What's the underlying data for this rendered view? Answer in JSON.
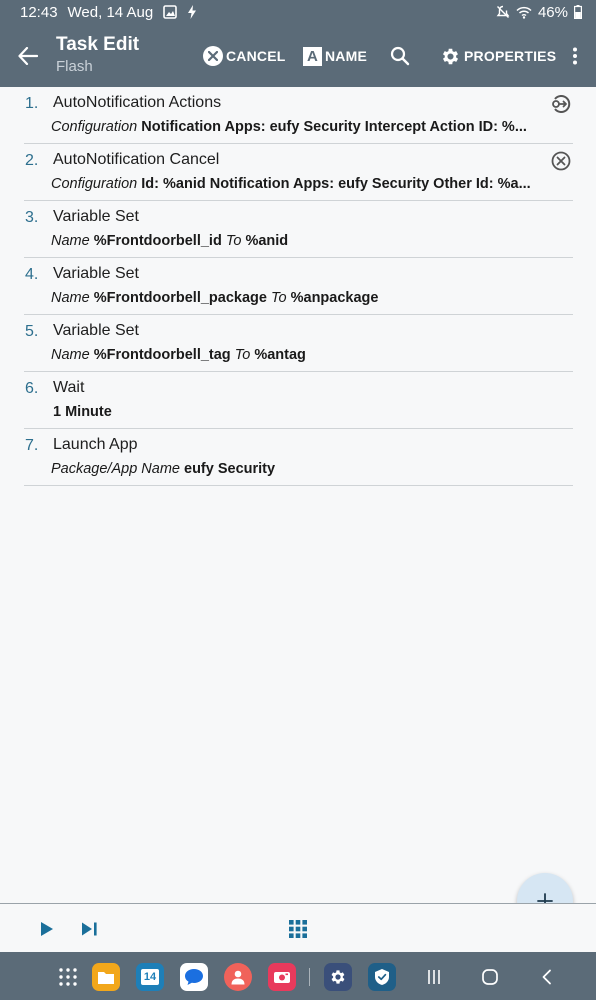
{
  "status_bar": {
    "time": "12:43",
    "date": "Wed, 14 Aug",
    "battery": "46%"
  },
  "app_bar": {
    "title": "Task Edit",
    "subtitle": "Flash",
    "cancel_label": "CANCEL",
    "name_label": "NAME",
    "name_icon_letter": "A",
    "properties_label": "PROPERTIES"
  },
  "actions": [
    {
      "num": "1.",
      "title": "AutoNotification Actions",
      "label": "Configuration",
      "value": "Notification Apps: eufy Security Intercept Action ID: %...",
      "icon": "plugin-exit-icon"
    },
    {
      "num": "2.",
      "title": "AutoNotification Cancel",
      "label": "Configuration",
      "value": "Id: %anid Notification Apps: eufy Security Other Id: %a...",
      "icon": "cancel-circle-icon"
    },
    {
      "num": "3.",
      "title": "Variable Set",
      "label": "Name",
      "value": "%Frontdoorbell_id",
      "to_label": "To",
      "to_value": "%anid"
    },
    {
      "num": "4.",
      "title": "Variable Set",
      "label": "Name",
      "value": "%Frontdoorbell_package",
      "to_label": "To",
      "to_value": "%anpackage"
    },
    {
      "num": "5.",
      "title": "Variable Set",
      "label": "Name",
      "value": "%Frontdoorbell_tag",
      "to_label": "To",
      "to_value": "%antag"
    },
    {
      "num": "6.",
      "title": "Wait",
      "value": "1 Minute"
    },
    {
      "num": "7.",
      "title": "Launch App",
      "label": "Package/App Name",
      "value": "eufy Security"
    }
  ],
  "taskbar": {
    "calendar_day": "14"
  },
  "colors": {
    "header": "#5b6b78",
    "accent_number": "#2d6f8e",
    "fab": "#d6e6f3",
    "toolbar_icon": "#1a6f9a"
  }
}
